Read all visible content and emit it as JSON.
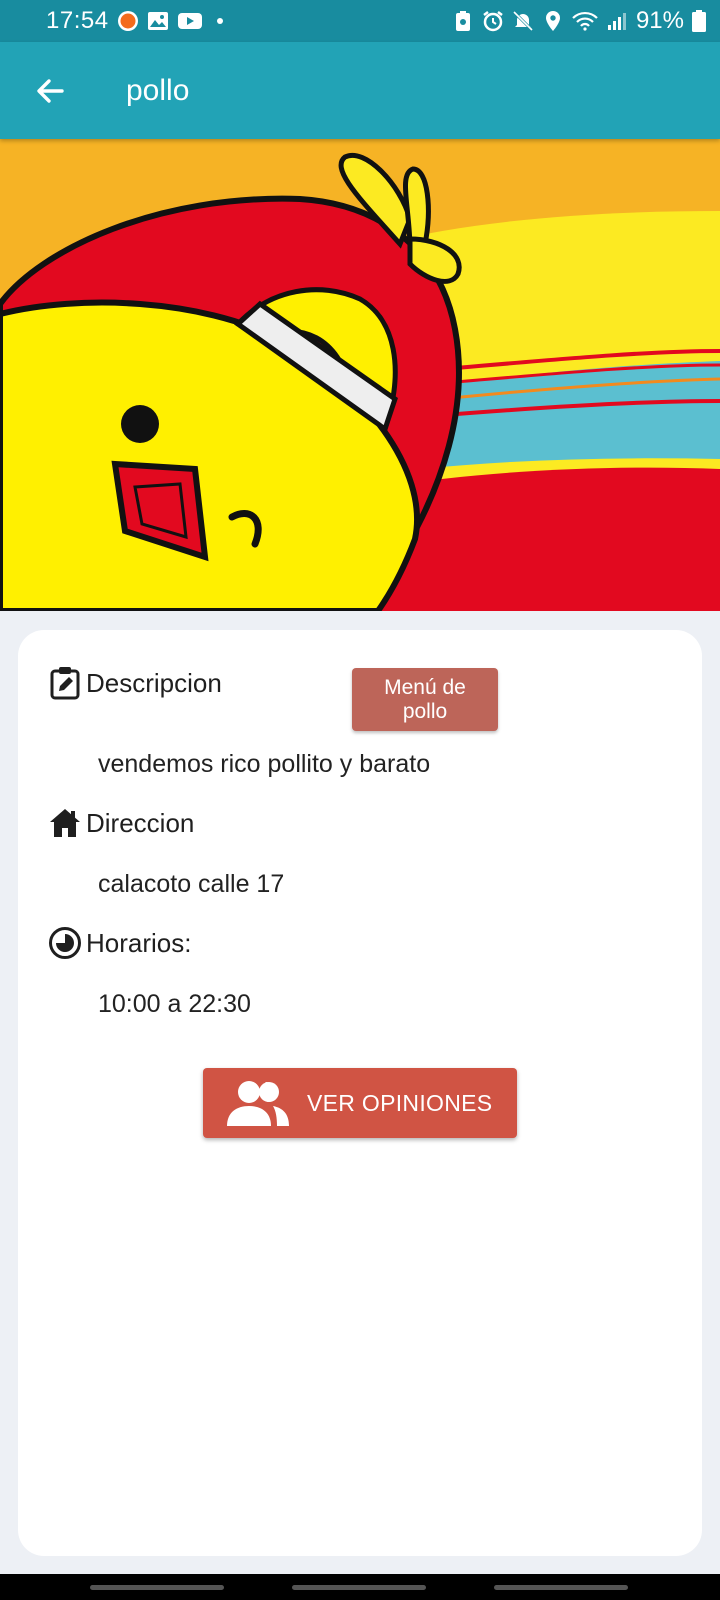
{
  "status_bar": {
    "time": "17:54",
    "battery": "91%",
    "icons_left": [
      "app-notification-icon",
      "gallery-icon",
      "youtube-icon",
      "dot-icon"
    ],
    "icons_right": [
      "battery-saver-icon",
      "alarm-icon",
      "mute-icon",
      "location-icon",
      "wifi-icon",
      "signal-icon",
      "battery-icon"
    ]
  },
  "app_bar": {
    "title": "pollo",
    "back_icon": "arrow-left-icon"
  },
  "hero": {
    "image": "chick-mascot-banner",
    "colors": {
      "orange": "#f6b325",
      "yellow": "#fcea22",
      "red": "#e2091f",
      "teal": "#5bbfd0"
    }
  },
  "details": {
    "description": {
      "label": "Descripcion",
      "value": "vendemos rico pollito y barato",
      "icon": "clipboard-edit-icon"
    },
    "menu_button": {
      "label": "Menú de pollo"
    },
    "address": {
      "label": "Direccion",
      "value": "calacoto calle 17",
      "icon": "house-icon"
    },
    "hours": {
      "label": "Horarios:",
      "value": "10:00 a 22:30",
      "icon": "clock-icon"
    },
    "opinions_button": {
      "label": "VER OPINIONES",
      "icon": "people-icon"
    }
  },
  "colors": {
    "status_bar": "#188c9f",
    "app_bar": "#22a3b6",
    "menu_button": "#bd6559",
    "opinions_button": "#d05444",
    "background": "#edf0f5"
  }
}
